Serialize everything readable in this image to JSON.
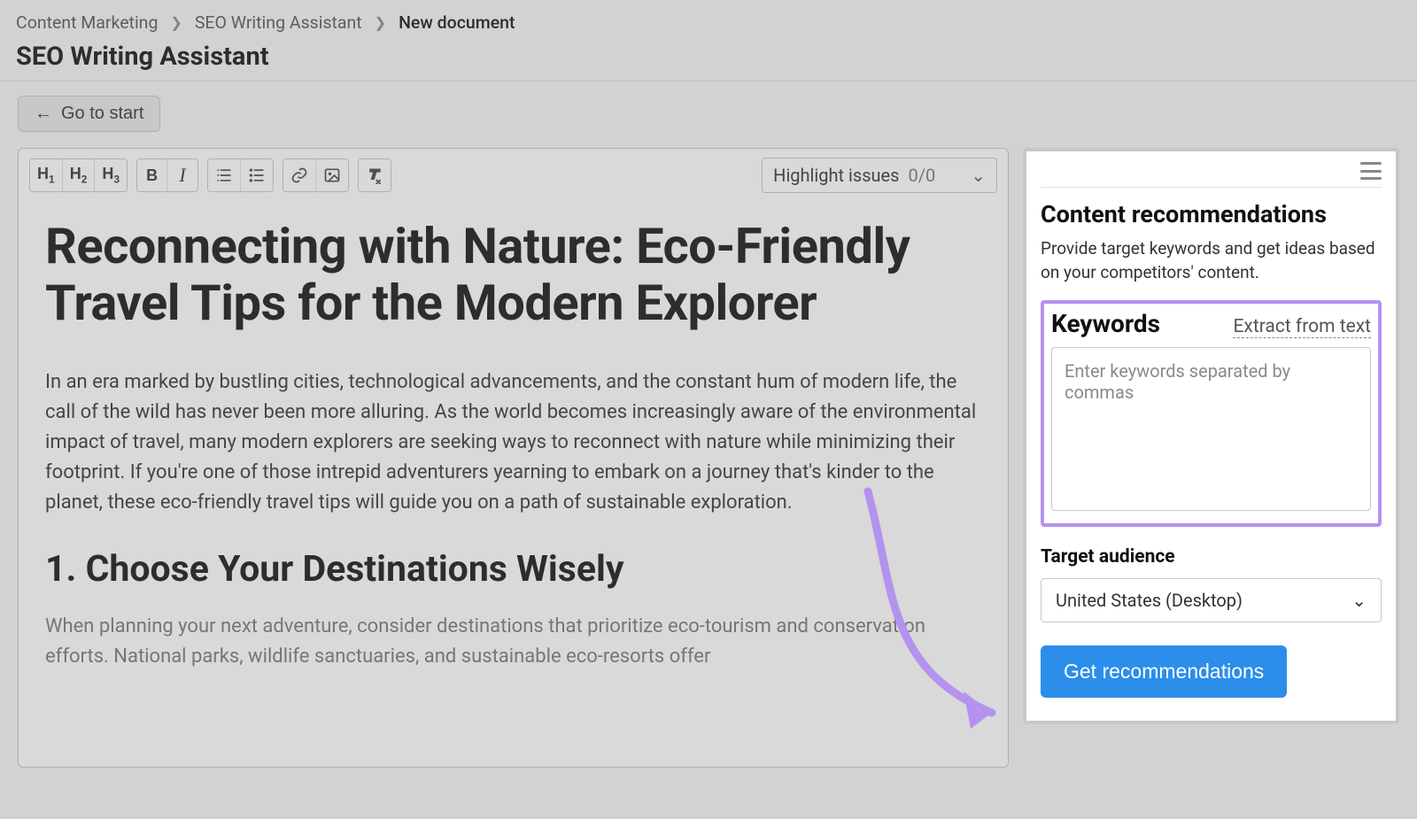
{
  "breadcrumb": {
    "items": [
      "Content Marketing",
      "SEO Writing Assistant",
      "New document"
    ]
  },
  "page_title": "SEO Writing Assistant",
  "go_to_start": "Go to start",
  "toolbar": {
    "h1": "H",
    "h1s": "1",
    "h2": "H",
    "h2s": "2",
    "h3": "H",
    "h3s": "3",
    "bold": "B",
    "italic": "I",
    "highlight_label": "Highlight issues",
    "highlight_count": "0/0"
  },
  "document": {
    "title": "Reconnecting with Nature: Eco-Friendly Travel Tips for the Modern Explorer",
    "para1": "In an era marked by bustling cities, technological advancements, and the constant hum of modern life, the call of the wild has never been more alluring. As the world becomes increasingly aware of the environmental impact of travel, many modern explorers are seeking ways to reconnect with nature while minimizing their footprint. If you're one of those intrepid adventurers yearning to embark on a journey that's kinder to the planet, these eco-friendly travel tips will guide you on a path of sustainable exploration.",
    "h2_1": "1. Choose Your Destinations Wisely",
    "para2": "When planning your next adventure, consider destinations that prioritize eco-tourism and conservation efforts. National parks, wildlife sanctuaries, and sustainable eco-resorts offer"
  },
  "sidebar": {
    "heading": "Content recommendations",
    "desc": "Provide target keywords and get ideas based on your competitors' content.",
    "keywords_label": "Keywords",
    "extract_label": "Extract from text",
    "keywords_placeholder": "Enter keywords separated by commas",
    "target_audience_label": "Target audience",
    "target_audience_value": "United States (Desktop)",
    "get_reco_label": "Get recommendations"
  }
}
